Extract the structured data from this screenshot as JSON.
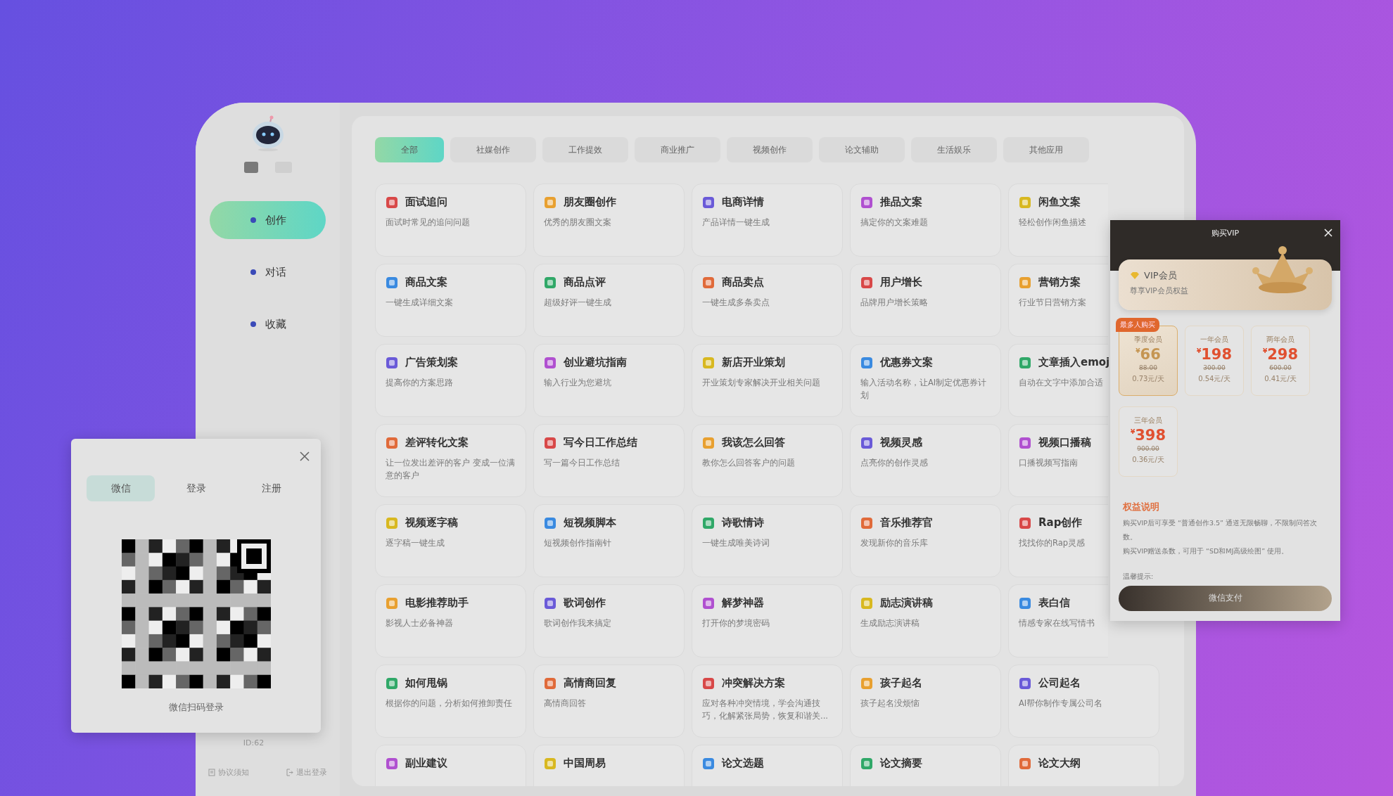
{
  "sidebar": {
    "nav": [
      {
        "label": "创作",
        "selected": true
      },
      {
        "label": "对话",
        "selected": false
      },
      {
        "label": "收藏",
        "selected": false
      }
    ],
    "user_id": "ID:62",
    "footer_links": [
      "协议须知",
      "退出登录"
    ]
  },
  "tabs": [
    {
      "label": "全部",
      "selected": true
    },
    {
      "label": "社媒创作",
      "selected": false
    },
    {
      "label": "工作提效",
      "selected": false
    },
    {
      "label": "商业推广",
      "selected": false
    },
    {
      "label": "视频创作",
      "selected": false
    },
    {
      "label": "论文辅助",
      "selected": false
    },
    {
      "label": "生活娱乐",
      "selected": false
    },
    {
      "label": "其他应用",
      "selected": false
    }
  ],
  "tools": [
    {
      "title": "面试追问",
      "desc": "面试时常见的追问问题"
    },
    {
      "title": "朋友圈创作",
      "desc": "优秀的朋友圈文案"
    },
    {
      "title": "电商详情",
      "desc": "产品详情一键生成"
    },
    {
      "title": "推品文案",
      "desc": "搞定你的文案难题"
    },
    {
      "title": "闲鱼文案",
      "desc": "轻松创作闲鱼描述"
    },
    {
      "title": "商品文案",
      "desc": "一键生成详细文案"
    },
    {
      "title": "商品点评",
      "desc": "超级好评一键生成"
    },
    {
      "title": "商品卖点",
      "desc": "一键生成多条卖点"
    },
    {
      "title": "用户增长",
      "desc": "品牌用户增长策略"
    },
    {
      "title": "营销方案",
      "desc": "行业节日营销方案"
    },
    {
      "title": "广告策划案",
      "desc": "提高你的方案思路"
    },
    {
      "title": "创业避坑指南",
      "desc": "输入行业为您避坑"
    },
    {
      "title": "新店开业策划",
      "desc": "开业策划专家解决开业相关问题"
    },
    {
      "title": "优惠券文案",
      "desc": "输入活动名称，让AI制定优惠券计划"
    },
    {
      "title": "文章插入emoj",
      "desc": "自动在文字中添加合适"
    },
    {
      "title": "差评转化文案",
      "desc": "让一位发出差评的客户 变成一位满意的客户"
    },
    {
      "title": "写今日工作总结",
      "desc": "写一篇今日工作总结"
    },
    {
      "title": "我该怎么回答",
      "desc": "教你怎么回答客户的问题"
    },
    {
      "title": "视频灵感",
      "desc": "点亮你的创作灵感"
    },
    {
      "title": "视频口播稿",
      "desc": "口播视频写指南"
    },
    {
      "title": "视频逐字稿",
      "desc": "逐字稿一键生成"
    },
    {
      "title": "短视频脚本",
      "desc": "短视频创作指南针"
    },
    {
      "title": "诗歌情诗",
      "desc": "一键生成唯美诗词"
    },
    {
      "title": "音乐推荐官",
      "desc": "发现新你的音乐库"
    },
    {
      "title": "Rap创作",
      "desc": "找找你的Rap灵感"
    },
    {
      "title": "电影推荐助手",
      "desc": "影视人士必备神器"
    },
    {
      "title": "歌词创作",
      "desc": "歌词创作我来搞定"
    },
    {
      "title": "解梦神器",
      "desc": "打开你的梦境密码"
    },
    {
      "title": "励志演讲稿",
      "desc": "生成励志演讲稿"
    },
    {
      "title": "表白信",
      "desc": "情感专家在线写情书"
    },
    {
      "title": "如何甩锅",
      "desc": "根据你的问题，分析如何推卸责任"
    },
    {
      "title": "高情商回复",
      "desc": "高情商回答"
    },
    {
      "title": "冲突解决方案",
      "desc": "应对各种冲突情境，学会沟通技巧，化解紧张局势，恢复和谐关..."
    },
    {
      "title": "孩子起名",
      "desc": "孩子起名没烦恼"
    },
    {
      "title": "公司起名",
      "desc": "AI帮你制作专属公司名"
    },
    {
      "title": "副业建议"
    },
    {
      "title": "中国周易"
    },
    {
      "title": "论文选题"
    },
    {
      "title": "论文摘要"
    },
    {
      "title": "论文大纲"
    }
  ],
  "vip_dialog": {
    "title": "购买VIP",
    "member_card": {
      "title": "VIP会员",
      "subtitle": "尊享VIP会员权益"
    },
    "currency": "¥",
    "plans": [
      {
        "name": "季度会员",
        "price": "66",
        "original": "88.00",
        "per_day": "0.73元/天",
        "badge": "最多人购买",
        "selected": true
      },
      {
        "name": "一年会员",
        "price": "198",
        "original": "300.00",
        "per_day": "0.54元/天",
        "selected": false
      },
      {
        "name": "两年会员",
        "price": "298",
        "original": "600.00",
        "per_day": "0.41元/天",
        "selected": false
      },
      {
        "name": "三年会员",
        "price": "398",
        "original": "900.00",
        "per_day": "0.36元/天",
        "selected": false
      }
    ],
    "benefits_title": "权益说明",
    "benefits": [
      "购买VIP后可享受 “普通创作3.5” 通道无限畅聊，不限制问答次数。",
      "购买VIP赠送条数，可用于 “SD和MJ高级绘图” 使用。"
    ],
    "tip_label": "温馨提示:",
    "pay_button": "微信支付"
  },
  "login_dialog": {
    "tabs": [
      {
        "label": "微信",
        "selected": true
      },
      {
        "label": "登录",
        "selected": false
      },
      {
        "label": "注册",
        "selected": false
      }
    ],
    "caption": "微信扫码登录"
  }
}
